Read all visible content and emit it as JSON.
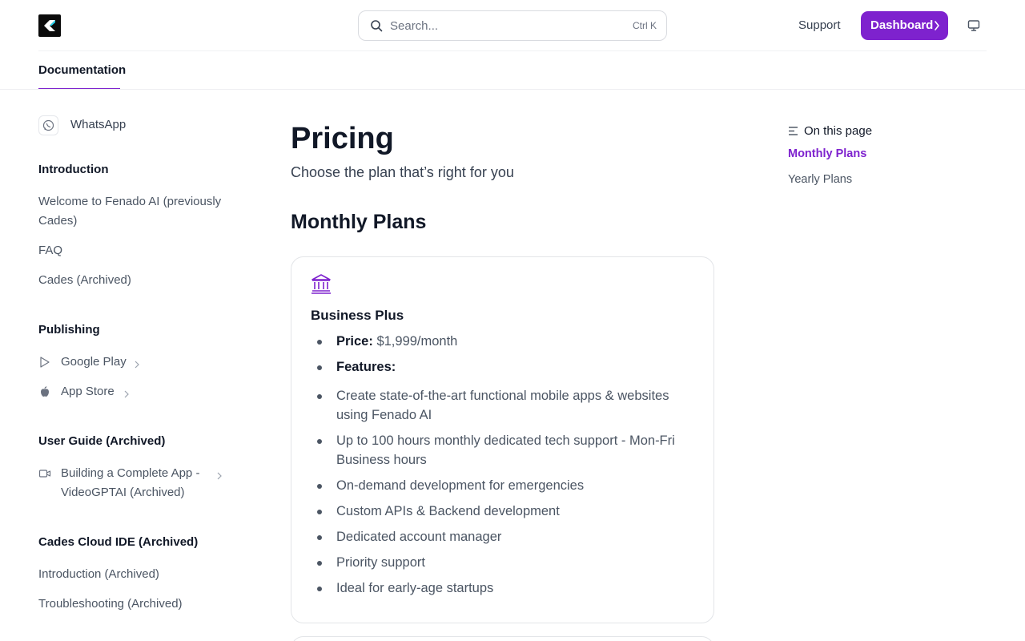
{
  "header": {
    "search_placeholder": "Search...",
    "search_shortcut": "Ctrl K",
    "support_label": "Support",
    "dashboard_label": "Dashboard"
  },
  "tabs": [
    {
      "label": "Documentation",
      "active": true
    }
  ],
  "sidebar": {
    "whatsapp_label": "WhatsApp",
    "sections": [
      {
        "heading": "Introduction",
        "items": [
          "Welcome to Fenado AI (previously Cades)",
          "FAQ",
          "Cades (Archived)"
        ]
      },
      {
        "heading": "Publishing",
        "items": [
          "Google Play",
          "App Store"
        ]
      },
      {
        "heading": "User Guide (Archived)",
        "items": [
          "Building a Complete App - VideoGPTAI (Archived)"
        ]
      },
      {
        "heading": "Cades Cloud IDE (Archived)",
        "items": [
          "Introduction (Archived)",
          "Troubleshooting (Archived)"
        ]
      }
    ]
  },
  "main": {
    "title": "Pricing",
    "subtitle": "Choose the plan that’s right for you",
    "section_title": "Monthly Plans",
    "plan": {
      "name": "Business Plus",
      "price_label": "Price:",
      "price_value": "$1,999/month",
      "features_label": "Features:",
      "features": [
        "Create state-of-the-art functional mobile apps & websites using Fenado AI",
        "Up to 100 hours monthly dedicated tech support - Mon-Fri Business hours",
        "On-demand development for emergencies",
        "Custom APIs & Backend development",
        "Dedicated account manager",
        "Priority support",
        "Ideal for early-age startups"
      ]
    }
  },
  "toc": {
    "title": "On this page",
    "items": [
      "Monthly Plans",
      "Yearly Plans"
    ],
    "active_index": 0
  },
  "colors": {
    "accent": "#7e22ce",
    "text": "#111827",
    "muted": "#4b5563"
  }
}
